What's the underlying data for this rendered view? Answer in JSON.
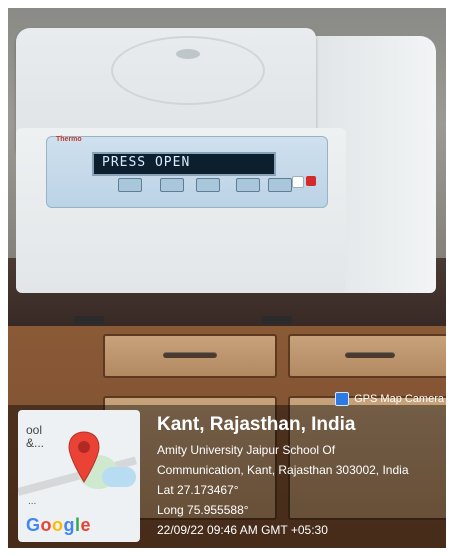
{
  "photo": {
    "centrifuge": {
      "brand": "Thermo",
      "display_text": "PRESS OPEN"
    }
  },
  "overlay": {
    "camera_badge": "GPS Map Camera",
    "map": {
      "label": "ool\n&...",
      "ellipsis": "...",
      "google": [
        "G",
        "o",
        "o",
        "g",
        "l",
        "e"
      ]
    },
    "location": {
      "title": "Kant, Rajasthan, India",
      "address_line1": "Amity University Jaipur School Of",
      "address_line2": "Communication, Kant, Rajasthan 303002, India",
      "lat": "Lat 27.173467°",
      "long": "Long 75.955588°",
      "datetime": "22/09/22 09:46 AM GMT +05:30"
    }
  },
  "colors": {
    "overlay_bg": "#000000",
    "pin": "#EA4335",
    "panel": "#bcd3e6"
  },
  "icons": {
    "camera": "camera-icon",
    "pin": "map-pin-icon"
  }
}
